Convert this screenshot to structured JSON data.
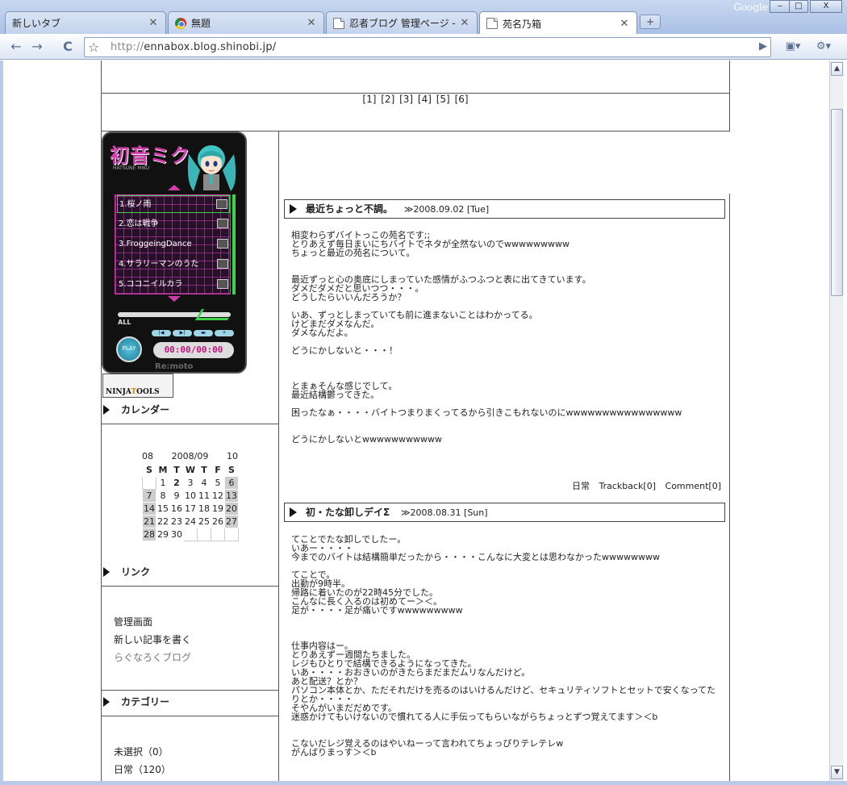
{
  "browser": {
    "tabs": [
      {
        "label": "新しいタブ",
        "icon": "blank"
      },
      {
        "label": "無題",
        "icon": "chrome-icon"
      },
      {
        "label": "忍者ブログ 管理ページ - NI...",
        "icon": "document-icon"
      },
      {
        "label": "苑名乃箱",
        "icon": "document-icon",
        "active": true
      }
    ],
    "new_tab": "+",
    "google_label": "Google",
    "window_buttons": [
      "‒",
      "□",
      "X"
    ],
    "nav": {
      "back": "←",
      "forward": "→",
      "reload": "C",
      "star": "☆",
      "go": "▶",
      "page_menu": "▣▾",
      "tools_menu": "⚙▾"
    },
    "url_scheme": "http://",
    "url_rest": "ennabox.blog.shinobi.jp/"
  },
  "pager": [
    "[1]",
    "[2]",
    "[3]",
    "[4]",
    "[5]",
    "[6]"
  ],
  "player": {
    "title": "初音ミク",
    "subtitle": "HATSUNE MIKU",
    "tracks": [
      "1.桜ノ雨",
      "2.恋は戦争",
      "3.FroggeingDance",
      "4.サラリーマンのうた",
      "5.ココニイルカラ"
    ],
    "repeat_label": "ALL",
    "controls": [
      "|◀",
      "▶|",
      "▬",
      "+"
    ],
    "play_label": "PLAY",
    "time": "00:00/00:00",
    "brand": "Re:moto"
  },
  "ninja_logo": {
    "part1": "NINJA",
    "part2": "T",
    "part3": "OOLS"
  },
  "sidebar": {
    "calendar_title": "カレンダー",
    "calendar": {
      "prev": "08",
      "current": "2008/09",
      "next": "10",
      "weekdays": [
        "S",
        "M",
        "T",
        "W",
        "T",
        "F",
        "S"
      ],
      "weeks": [
        [
          "",
          "1",
          "2",
          "3",
          "4",
          "5",
          "6"
        ],
        [
          "7",
          "8",
          "9",
          "10",
          "11",
          "12",
          "13"
        ],
        [
          "14",
          "15",
          "16",
          "17",
          "18",
          "19",
          "20"
        ],
        [
          "21",
          "22",
          "23",
          "24",
          "25",
          "26",
          "27"
        ],
        [
          "28",
          "29",
          "30",
          "",
          "",
          "",
          ""
        ]
      ],
      "today": "2"
    },
    "links_title": "リンク",
    "links": [
      "管理画面",
      "新しい記事を書く",
      "らぐなろくブログ"
    ],
    "category_title": "カテゴリー",
    "categories": [
      "未選択（0）",
      "日常（120）"
    ]
  },
  "posts": [
    {
      "title": "最近ちょっと不調。",
      "date": "≫2008.09.02 [Tue]",
      "body": "相変わらずバイトっこの苑名です;;\nとりあえず毎日まいにちバイトでネタが全然ないのでwwwwwwwww\nちょっと最近の苑名について。\n\n\n最近ずっと心の奥底にしまっていた感情がふつふつと表に出てきています。\nダメだダメだと思いつつ・・・。\nどうしたらいいんだろうか？\n\nいあ、ずっとしまっていても前に進まないことはわかってる。\nけどまだダメなんだ。\nダメなんだよ。\n\nどうにかしないと・・・！\n\n\n\nとまぁそんな感じでして。\n最近結構鬱ってきた。\n\n困ったなぁ・・・・バイトつまりまくってるから引きこもれないのにwwwwwwwwwwwwwwww\n\n\nどうにかしないとwwwwwwwwwww",
      "footer": {
        "category": "日常",
        "trackback": "Trackback[0]",
        "comment": "Comment[0]"
      }
    },
    {
      "title": "初・たな卸しデイΣ",
      "date": "≫2008.08.31 [Sun]",
      "body": "てことでたな卸しでしたー。\nいあー・・・・\n今までのバイトは結構簡単だったから・・・・こんなに大変とは思わなかったwwwwwwww\n\nてことで。\n出勤が9時半。\n帰路に着いたのが22時45分でした。\nこんなに長く入るのは初めてー＞＜。\n足が・・・・足が痛いですwwwwwwwww\n\n\n\n仕事内容はー。\nとりあえずー週間たちました。\nレジもひとりで結構できるようになってきた。\nいあ・・・・おおきいのがきたらまだまだムリなんだけど。\nあと配送？とか？\nパソコン本体とか、ただそれだけを売るのはいけるんだけど、セキュリティソフトとセットで安くなってたりとか・・・・\nそやんがいまだだめです。\n迷惑かけてもいけないので慣れてる人に手伝ってもらいながらちょっとずつ覚えてます＞＜b\n\n\nこないだレジ覚えるのはやいねーって言われてちょっぴりテレテレw\nがんばりまっす＞＜b"
    }
  ]
}
